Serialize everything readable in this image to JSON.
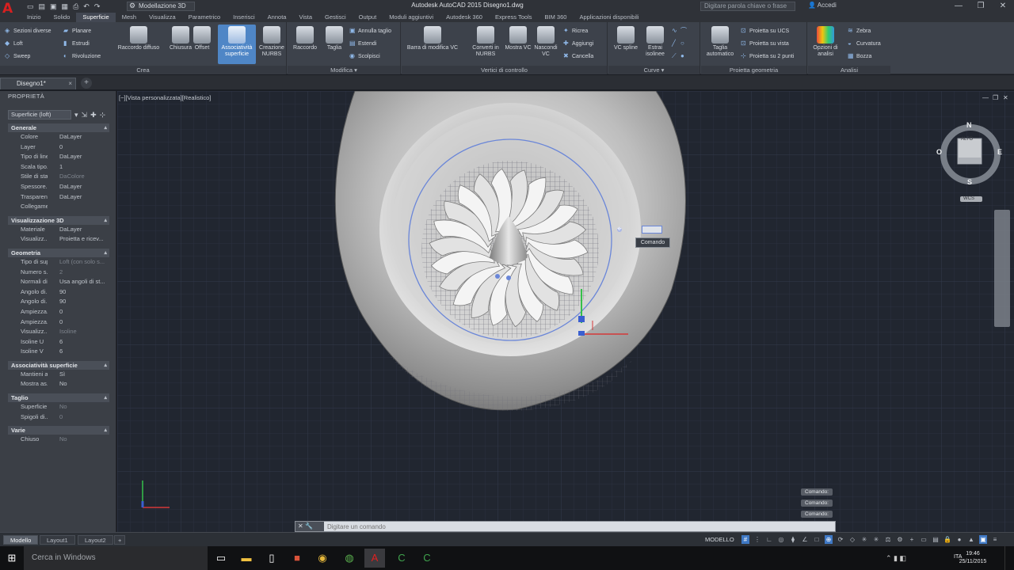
{
  "app": {
    "title": "Autodesk AutoCAD 2015   Disegno1.dwg",
    "workspace": "Modellazione 3D",
    "search_placeholder": "Digitare parola chiave o frase",
    "login": "Accedi"
  },
  "menu_tabs": [
    "Inizio",
    "Solido",
    "Superficie",
    "Mesh",
    "Visualizza",
    "Parametrico",
    "Inserisci",
    "Annota",
    "Vista",
    "Gestisci",
    "Output",
    "Moduli aggiuntivi",
    "Autodesk 360",
    "Express Tools",
    "BIM 360",
    "Applicazioni disponibili"
  ],
  "ribbon": {
    "create": {
      "label": "Crea",
      "small": [
        "Sezioni diverse",
        "Loft",
        "Sweep",
        "Planare",
        "Estrudi",
        "Rivoluzione"
      ],
      "big": [
        "Raccordo diffuso",
        "Chiusura",
        "Offset",
        "Associatività superficie",
        "Creazione NURBS"
      ]
    },
    "edit": {
      "label": "Modifica",
      "big": [
        "Raccordo",
        "Taglia"
      ],
      "small": [
        "Annulla taglio",
        "Estendi",
        "Scolpisci"
      ]
    },
    "cv": {
      "label": "Vertici di controllo",
      "big": [
        "Barra di modifica VC",
        "Converti in NURBS",
        "Mostra VC",
        "Nascondi VC"
      ],
      "small": [
        "Ricrea",
        "Aggiungi",
        "Cancella"
      ]
    },
    "curves": {
      "label": "Curve",
      "big": [
        "VC spline",
        "Estrai isolinee"
      ]
    },
    "project": {
      "label": "Proietta geometria",
      "big": [
        "Taglia automatico"
      ],
      "small": [
        "Proietta su UCS",
        "Proietta su vista",
        "Proietta su 2 punti"
      ]
    },
    "analysis": {
      "label": "Analisi",
      "big": [
        "Opzioni di analisi"
      ],
      "small": [
        "Zebra",
        "Curvatura",
        "Bozza"
      ]
    }
  },
  "document_tab": "Disegno1*",
  "properties": {
    "title": "PROPRIETÀ",
    "selection": "Superficie (loft)",
    "sections": [
      {
        "name": "Generale",
        "rows": [
          [
            "Colore",
            "DaLayer",
            false
          ],
          [
            "Layer",
            "0",
            false
          ],
          [
            "Tipo di linea",
            "DaLayer",
            false
          ],
          [
            "Scala tipo...",
            "1",
            false
          ],
          [
            "Stile di sta...",
            "DaColore",
            true
          ],
          [
            "Spessore...",
            "DaLayer",
            false
          ],
          [
            "Trasparenza",
            "DaLayer",
            false
          ],
          [
            "Collegame...",
            "",
            false
          ]
        ]
      },
      {
        "name": "Visualizzazione 3D",
        "rows": [
          [
            "Materiale",
            "DaLayer",
            false
          ],
          [
            "Visualizz...",
            "Proietta e ricev...",
            false
          ]
        ]
      },
      {
        "name": "Geometria",
        "rows": [
          [
            "Tipo di sup...",
            "Loft (con solo s...",
            true
          ],
          [
            "Numero s...",
            "2",
            true
          ],
          [
            "Normali di...",
            "Usa angoli di st...",
            false
          ],
          [
            "Angolo di...",
            "90",
            false
          ],
          [
            "Angolo di...",
            "90",
            false
          ],
          [
            "Ampiezza...",
            "0",
            false
          ],
          [
            "Ampiezza...",
            "0",
            false
          ],
          [
            "Visualizz...",
            "Isoline",
            true
          ],
          [
            "Isoline U",
            "6",
            false
          ],
          [
            "Isoline V",
            "6",
            false
          ]
        ]
      },
      {
        "name": "Associatività superficie",
        "rows": [
          [
            "Mantieni a...",
            "Sì",
            false
          ],
          [
            "Mostra as...",
            "No",
            false
          ]
        ]
      },
      {
        "name": "Taglio",
        "rows": [
          [
            "Superficie...",
            "No",
            true
          ],
          [
            "Spigoli di...",
            "0",
            true
          ]
        ]
      },
      {
        "name": "Varie",
        "rows": [
          [
            "Chiuso",
            "No",
            true
          ]
        ]
      }
    ]
  },
  "viewport": {
    "label": "[−][Vista personalizzata][Realistico]",
    "viewcube": {
      "top": "ALTO",
      "n": "N",
      "s": "S",
      "e": "E",
      "w": "O",
      "wcs": "WCS"
    },
    "tooltip": "Comando"
  },
  "command": {
    "history": [
      "Comando:",
      "Comando:",
      "Comando:"
    ],
    "placeholder": "Digitare un comando"
  },
  "layout_tabs": [
    "Modello",
    "Layout1",
    "Layout2"
  ],
  "status": {
    "model": "MODELLO"
  },
  "taskbar": {
    "search": "Cerca in Windows",
    "time": "19:46",
    "date": "25/11/2015",
    "lang": "ITA"
  },
  "colors": {
    "accent": "#4f86c6",
    "viewport": "#212630",
    "ribbon": "#3d424b"
  }
}
